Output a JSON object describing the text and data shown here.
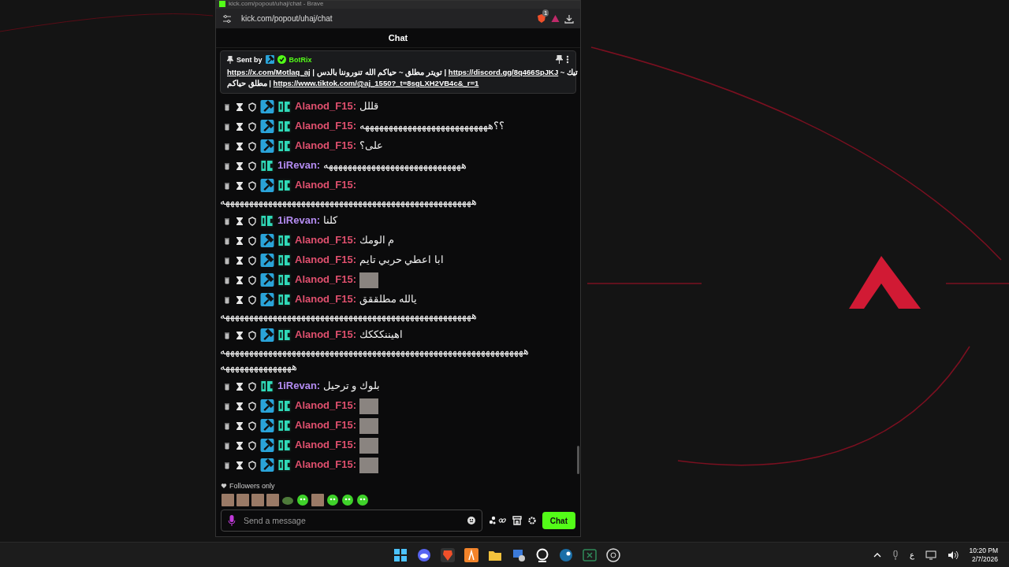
{
  "browser": {
    "title": "kick.com/popout/uhaj/chat - Brave",
    "url": "kick.com/popout/uhaj/chat",
    "shields_count": "1"
  },
  "chat": {
    "header": "Chat",
    "pinned": {
      "sent_by": "Sent by",
      "sender": "BotRix",
      "lines": [
        [
          {
            "text": "تيك ~ ",
            "link": false
          },
          {
            "text": "https://discord.gg/8q466SpJKJ",
            "link": true
          },
          {
            "text": " | تويتر مطلق ~ حياكم الله تنوروننا بالدس | ",
            "link": false
          },
          {
            "text": "https://x.com/Motlaq_aj",
            "link": true
          }
        ],
        [
          {
            "text": "https://www.tiktok.com/@aj_1550?_t=8sgLXH2VB4c&_r=1",
            "link": true
          },
          {
            "text": " | مطلق حياكم",
            "link": false
          }
        ]
      ]
    },
    "messages": [
      {
        "user": "Alanod_F15:",
        "color": "#e0506e",
        "moderator": true,
        "text": "قللل",
        "emote": false
      },
      {
        "user": "Alanod_F15:",
        "color": "#e0506e",
        "moderator": true,
        "text": "؟؟هههههههههههههههههههههههههههه",
        "emote": false
      },
      {
        "user": "Alanod_F15:",
        "color": "#e0506e",
        "moderator": true,
        "text": "على؟",
        "emote": false
      },
      {
        "user": "1iRevan:",
        "color": "#b48cf2",
        "moderator": false,
        "text": "هههههههههههههههههههههههههههههه",
        "emote": false
      },
      {
        "user": "Alanod_F15:",
        "color": "#e0506e",
        "moderator": true,
        "continuation": [
          "هههههههههههههههههههههههههههههههههههههههههههههههههههههه"
        ],
        "emote": false
      },
      {
        "user": "1iRevan:",
        "color": "#b48cf2",
        "moderator": false,
        "text": "كلنا",
        "emote": false
      },
      {
        "user": "Alanod_F15:",
        "color": "#e0506e",
        "moderator": true,
        "text": "م الومك",
        "emote": false
      },
      {
        "user": "Alanod_F15:",
        "color": "#e0506e",
        "moderator": true,
        "text": "ابا اعطي حربي تايم",
        "emote": false
      },
      {
        "user": "Alanod_F15:",
        "color": "#e0506e",
        "moderator": true,
        "emote": true
      },
      {
        "user": "Alanod_F15:",
        "color": "#e0506e",
        "moderator": true,
        "text": "يالله مطلققق",
        "continuation": [
          "هههههههههههههههههههههههههههههههههههههههههههههههههههههه"
        ],
        "emote": false
      },
      {
        "user": "Alanod_F15:",
        "color": "#e0506e",
        "moderator": true,
        "text": "اهيننكككك",
        "continuation": [
          "ههههههههههههههههههههههههههههههههههههههههههههههههههههههههههههههههه",
          "هههههههههههههههه"
        ],
        "emote": false
      },
      {
        "user": "1iRevan:",
        "color": "#b48cf2",
        "moderator": false,
        "text": "بلوك و ترحيل",
        "emote": false
      },
      {
        "user": "Alanod_F15:",
        "color": "#e0506e",
        "moderator": true,
        "emote": true
      },
      {
        "user": "Alanod_F15:",
        "color": "#e0506e",
        "moderator": true,
        "emote": true
      },
      {
        "user": "Alanod_F15:",
        "color": "#e0506e",
        "moderator": true,
        "emote": true
      },
      {
        "user": "Alanod_F15:",
        "color": "#e0506e",
        "moderator": true,
        "emote": true
      }
    ],
    "mode": "Followers only",
    "recent_emotes": [
      {
        "kind": "photo"
      },
      {
        "kind": "photo"
      },
      {
        "kind": "photo"
      },
      {
        "kind": "photo"
      },
      {
        "kind": "frog"
      },
      {
        "kind": "blob"
      },
      {
        "kind": "photo"
      },
      {
        "kind": "blob"
      },
      {
        "kind": "blob"
      },
      {
        "kind": "blob"
      }
    ],
    "input": {
      "placeholder": "Send a message"
    },
    "send_button": "Chat"
  },
  "taskbar": {
    "language": "ع",
    "time": "10:20 PM",
    "date": "2/7/2026"
  }
}
